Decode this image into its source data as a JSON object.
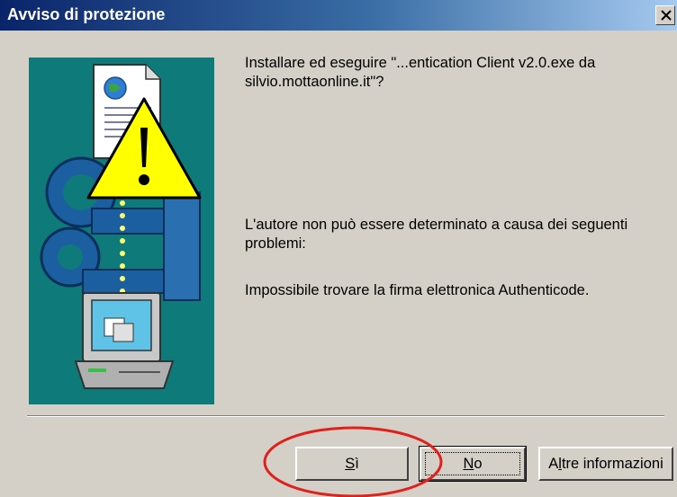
{
  "window": {
    "title": "Avviso di protezione",
    "close_label": "×"
  },
  "message": {
    "line1": "Installare ed eseguire \"...entication Client v2.0.exe da silvio.mottaonline.it\"?",
    "line2": "L'autore non può essere determinato a causa dei seguenti problemi:",
    "line3": "Impossibile trovare la firma elettronica Authenticode."
  },
  "buttons": {
    "yes": {
      "accel": "S",
      "rest": "ì"
    },
    "no": {
      "accel": "N",
      "rest": "o"
    },
    "more": {
      "pre": "A",
      "accel": "l",
      "rest": "tre informazioni"
    }
  },
  "colors": {
    "dialog_bg": "#d4d0c8",
    "title_start": "#0a246a",
    "title_end": "#a6caf0",
    "illustration_bg": "#0f7a7a",
    "annotation": "#e0201b"
  },
  "icons": [
    "close-icon",
    "document-icon",
    "warning-icon",
    "keys-icon",
    "computer-icon"
  ]
}
